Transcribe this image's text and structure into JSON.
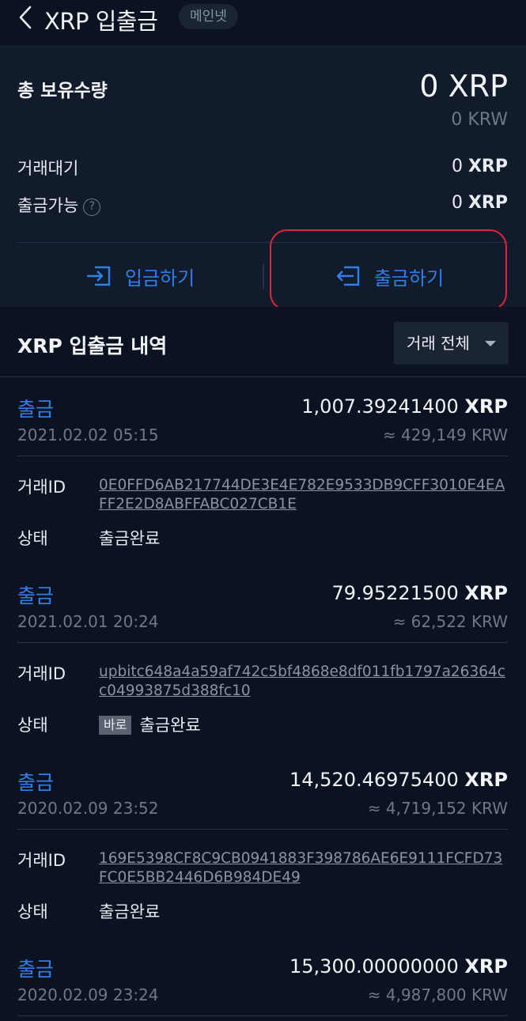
{
  "header": {
    "title": "XRP 입출금",
    "network_badge": "메인넷",
    "back_icon": "chevron-left-icon"
  },
  "summary": {
    "total_label": "총 보유수량",
    "total_amount": "0 XRP",
    "total_krw": "0 KRW",
    "pending_label": "거래대기",
    "pending_value": "0",
    "pending_unit": "XRP",
    "withdrawable_label": "출금가능",
    "withdrawable_value": "0",
    "withdrawable_unit": "XRP",
    "help_icon_text": "?"
  },
  "actions": {
    "deposit_label": "입금하기",
    "withdraw_label": "출금하기",
    "accent_color": "#2f7fe6",
    "highlight_color": "#e0243b"
  },
  "history": {
    "title": "XRP 입출금 내역",
    "filter_label": "거래 전체",
    "id_label": "거래ID",
    "status_label": "상태",
    "transactions": [
      {
        "type": "출금",
        "date": "2021.02.02 05:15",
        "amount": "1,007.39241400",
        "unit": "XRP",
        "krw": "≈ 429,149 KRW",
        "txid": "0E0FFD6AB217744DE3E4E782E9533DB9CFF3010E4EAFF2E2D8ABFFABC027CB1E",
        "tag": "",
        "status": "출금완료"
      },
      {
        "type": "출금",
        "date": "2021.02.01 20:24",
        "amount": "79.95221500",
        "unit": "XRP",
        "krw": "≈ 62,522 KRW",
        "txid": "upbitc648a4a59af742c5bf4868e8df011fb1797a26364cc04993875d388fc10",
        "tag": "바로",
        "status": "출금완료"
      },
      {
        "type": "출금",
        "date": "2020.02.09 23:52",
        "amount": "14,520.46975400",
        "unit": "XRP",
        "krw": "≈ 4,719,152 KRW",
        "txid": "169E5398CF8C9CB0941883F398786AE6E9111FCFD73FC0E5BB2446D6B984DE49",
        "tag": "",
        "status": "출금완료"
      },
      {
        "type": "출금",
        "date": "2020.02.09 23:24",
        "amount": "15,300.00000000",
        "unit": "XRP",
        "krw": "≈ 4,987,800 KRW",
        "txid": "",
        "tag": "",
        "status": ""
      }
    ]
  }
}
